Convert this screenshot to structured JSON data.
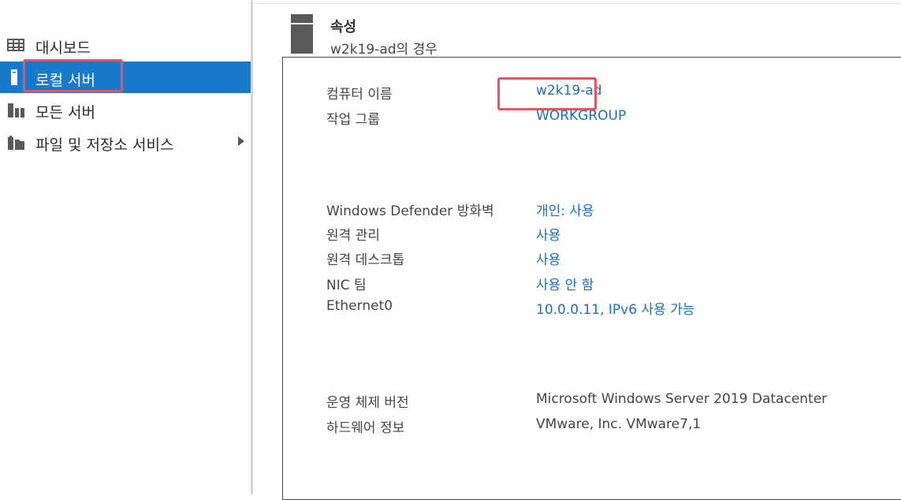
{
  "sidebar": {
    "items": [
      {
        "label": "대시보드"
      },
      {
        "label": "로컬 서버"
      },
      {
        "label": "모든 서버"
      },
      {
        "label": "파일 및 저장소 서비스"
      }
    ]
  },
  "header": {
    "title": "속성",
    "subtitle": "w2k19-ad의 경우"
  },
  "properties": {
    "computer_name": {
      "label": "컴퓨터 이름",
      "value": "w2k19-ad"
    },
    "workgroup": {
      "label": "작업 그룹",
      "value": "WORKGROUP"
    },
    "firewall": {
      "label": "Windows Defender 방화벽",
      "value": "개인: 사용"
    },
    "remote_mgmt": {
      "label": "원격 관리",
      "value": "사용"
    },
    "remote_desktop": {
      "label": "원격 데스크톱",
      "value": "사용"
    },
    "nic_teaming": {
      "label": "NIC 팀",
      "value": "사용 안 함"
    },
    "ethernet": {
      "label": "Ethernet0",
      "value": "10.0.0.11, IPv6 사용 가능"
    },
    "os_version": {
      "label": "운영 체제 버전",
      "value": "Microsoft Windows Server 2019 Datacenter"
    },
    "hardware": {
      "label": "하드웨어 정보",
      "value": "VMware, Inc. VMware7,1"
    }
  },
  "colors": {
    "selected_nav": "#1979ca",
    "link": "#1a6fbf",
    "highlight": "#e8545a"
  },
  "icons": {
    "dashboard": "dashboard-grid-icon",
    "local_server": "local-server-icon",
    "all_servers": "all-servers-icon",
    "file_storage": "file-storage-icon",
    "expand": "chevron-right-icon",
    "server": "server-tower-icon"
  }
}
